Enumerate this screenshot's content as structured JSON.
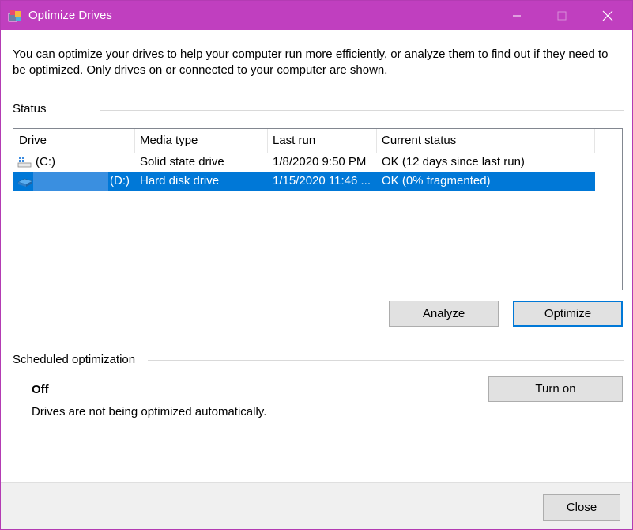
{
  "window": {
    "title": "Optimize Drives",
    "accent_color": "#c03fbf",
    "controls": {
      "minimize_icon": "minimize-icon",
      "maximize_icon": "maximize-icon",
      "close_icon": "close-icon"
    }
  },
  "intro_text": "You can optimize your drives to help your computer run more efficiently, or analyze them to find out if they need to be optimized. Only drives on or connected to your computer are shown.",
  "status": {
    "section_label": "Status",
    "columns": [
      "Drive",
      "Media type",
      "Last run",
      "Current status"
    ],
    "drives": [
      {
        "drive": "(C:)",
        "icon": "windows-drive-icon",
        "media_type": "Solid state drive",
        "last_run": "1/8/2020 9:50 PM",
        "current_status": "OK (12 days since last run)",
        "selected": false
      },
      {
        "drive": "(D:)",
        "icon": "hard-drive-icon",
        "media_type": "Hard disk drive",
        "last_run": "1/15/2020 11:46 ...",
        "current_status": "OK (0% fragmented)",
        "selected": true
      }
    ],
    "selection_color": "#0078d7"
  },
  "buttons": {
    "analyze": "Analyze",
    "optimize": "Optimize"
  },
  "scheduled": {
    "section_label": "Scheduled optimization",
    "state": "Off",
    "description": "Drives are not being optimized automatically.",
    "turn_on": "Turn on"
  },
  "footer": {
    "close": "Close"
  }
}
